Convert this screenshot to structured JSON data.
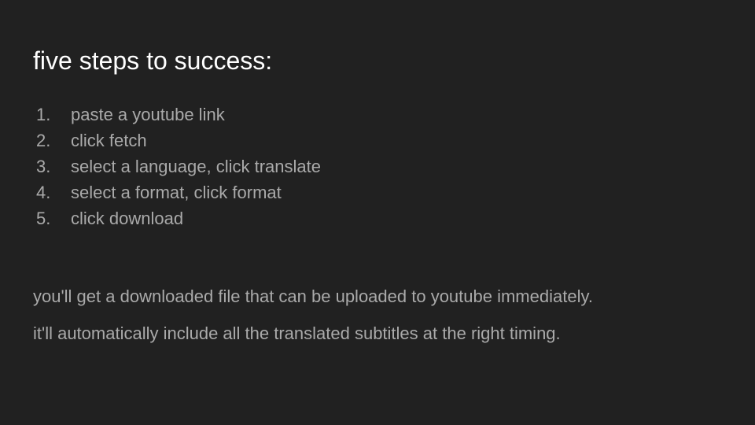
{
  "slide": {
    "title": "five steps to success:",
    "steps": [
      {
        "number": "1.",
        "text": "paste a youtube link"
      },
      {
        "number": "2.",
        "text": "click fetch"
      },
      {
        "number": "3.",
        "text": "select a language, click translate"
      },
      {
        "number": "4.",
        "text": "select a format, click format"
      },
      {
        "number": "5.",
        "text": "click download"
      }
    ],
    "notes": [
      "you'll get a downloaded file that can be uploaded to youtube immediately.",
      "it'll automatically include all the translated subtitles at the right timing."
    ]
  },
  "colors": {
    "background": "#212121",
    "title": "#ffffff",
    "body_text": "#aaaaaa"
  }
}
